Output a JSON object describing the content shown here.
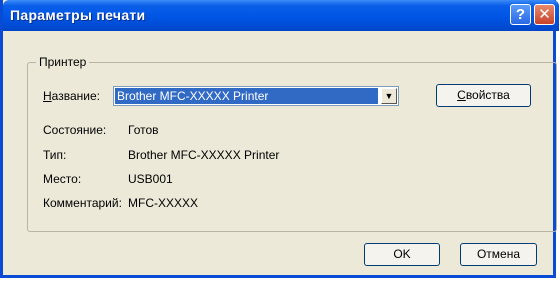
{
  "window": {
    "title": "Параметры печати"
  },
  "titlebar": {
    "help_glyph": "?",
    "close_glyph": "✕"
  },
  "printer_group": {
    "legend": "Принтер",
    "name_label_accel": "Н",
    "name_label_rest": "азвание:",
    "name_value": "Brother MFC-XXXXX  Printer",
    "properties_accel": "С",
    "properties_rest": "войства",
    "status_label": "Состояние:",
    "status_value": "Готов",
    "type_label": "Тип:",
    "type_value": "Brother MFC-XXXXX  Printer",
    "location_label": "Место:",
    "location_value": "USB001",
    "comment_label": "Комментарий:",
    "comment_value": "MFC-XXXXX"
  },
  "buttons": {
    "ok": "OK",
    "cancel": "Отмена"
  },
  "colors": {
    "titlebar": "#0055e5",
    "dialog_bg": "#ece9d8",
    "selection": "#316ac5"
  }
}
